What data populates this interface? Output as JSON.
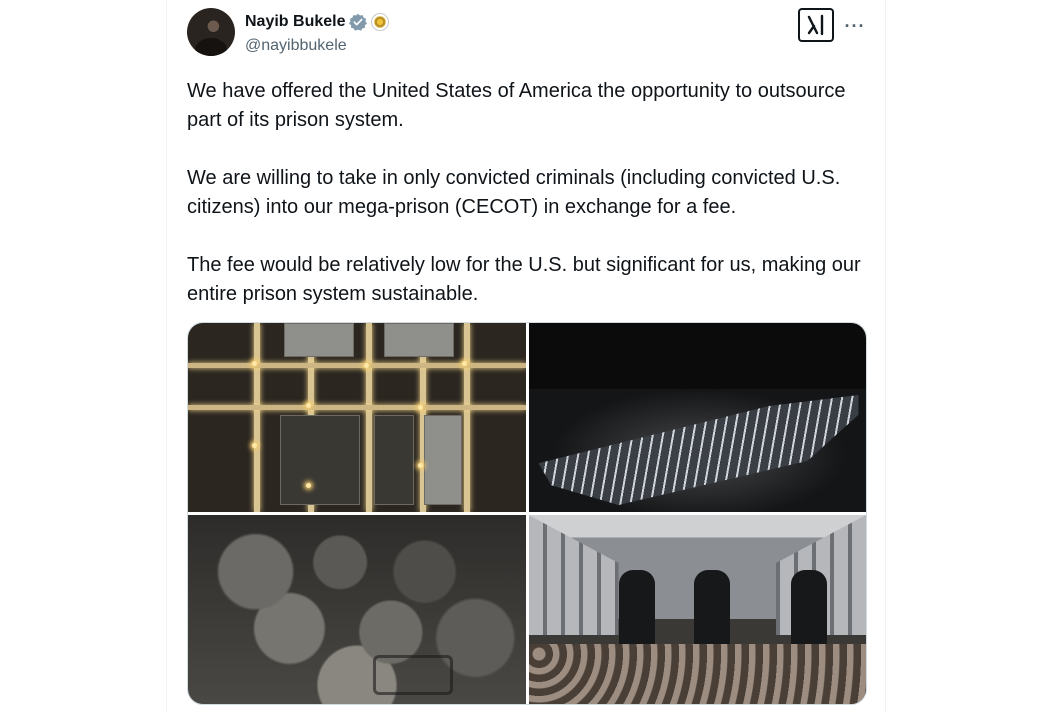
{
  "post": {
    "author": {
      "display_name": "Nayib Bukele",
      "handle": "@nayibbukele"
    },
    "icons": {
      "verified": "verified-badge-icon",
      "affiliation": "government-seal-icon",
      "grok": "grok-icon",
      "more": "more-options-icon"
    },
    "more_label": "···",
    "text": [
      "We have offered the United States of America the opportunity to outsource part of its prison system.",
      "We are willing to take in only convicted criminals (including convicted U.S. citizens) into our mega-prison (CECOT) in exchange for a fee.",
      "The fee would be relatively low for the U.S. but significant for us, making our entire prison system sustainable."
    ]
  },
  "colors": {
    "text": "#0f1419",
    "secondary": "#536471",
    "verified": "#829aab",
    "border": "#cfd9de"
  }
}
